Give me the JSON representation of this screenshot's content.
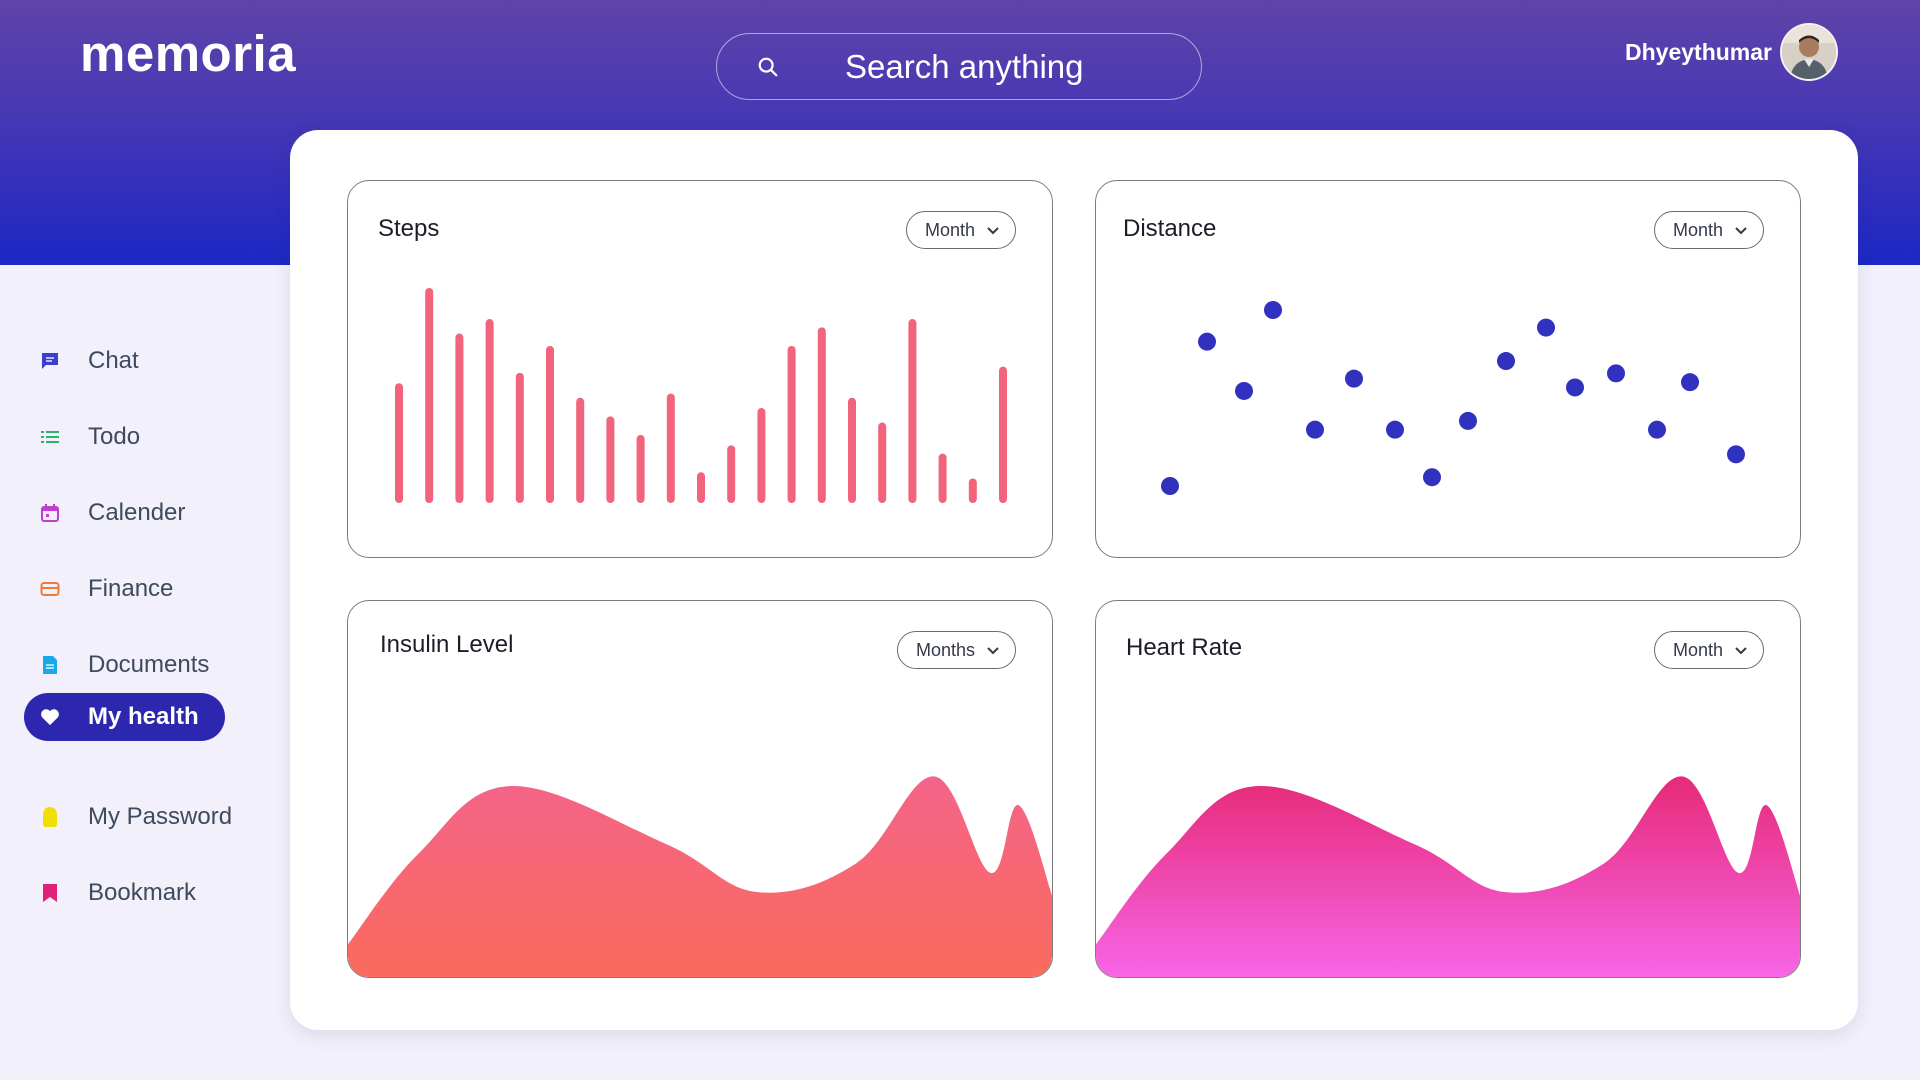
{
  "header": {
    "brand": "memoria",
    "search_placeholder": "Search anything",
    "user_name": "Dhyeythumar"
  },
  "sidebar": {
    "items": [
      {
        "label": "Chat",
        "icon": "chat-icon",
        "color": "#3b3fd0",
        "active": false
      },
      {
        "label": "Todo",
        "icon": "list-icon",
        "color": "#2fb36a",
        "active": false
      },
      {
        "label": "Calender",
        "icon": "calendar-icon",
        "color": "#c13fd0",
        "active": false
      },
      {
        "label": "Finance",
        "icon": "card-icon",
        "color": "#f07a3a",
        "active": false
      },
      {
        "label": "Documents",
        "icon": "document-icon",
        "color": "#1aa9e8",
        "active": false
      },
      {
        "label": "My health",
        "icon": "heart-icon",
        "color": "#ffffff",
        "active": true
      },
      {
        "label": "My Password",
        "icon": "lock-icon",
        "color": "#f0e000",
        "active": false
      },
      {
        "label": "Bookmark",
        "icon": "bookmark-icon",
        "color": "#e0207a",
        "active": false
      }
    ]
  },
  "cards": {
    "steps": {
      "title": "Steps",
      "dropdown": "Month"
    },
    "distance": {
      "title": "Distance",
      "dropdown": "Month"
    },
    "insulin": {
      "title": "Insulin Level",
      "dropdown": "Months"
    },
    "heart": {
      "title": "Heart Rate",
      "dropdown": "Month"
    }
  },
  "colors": {
    "bar": "#f2637c",
    "dot": "#3131c0",
    "insulin_gradient": [
      "#f46489",
      "#fb6a5c"
    ],
    "heart_gradient": [
      "#e62a77",
      "#f866e8"
    ]
  },
  "chart_data": [
    {
      "type": "bar",
      "title": "Steps",
      "ylim": [
        0,
        100
      ],
      "values": [
        54,
        100,
        78,
        85,
        59,
        72,
        47,
        38,
        29,
        49,
        11,
        24,
        42,
        72,
        81,
        47,
        35,
        85,
        20,
        8,
        62
      ]
    },
    {
      "type": "scatter",
      "title": "Distance",
      "xlim": [
        0,
        18
      ],
      "ylim": [
        0,
        100
      ],
      "points": [
        {
          "x": 0,
          "y": 0
        },
        {
          "x": 1,
          "y": 82
        },
        {
          "x": 2,
          "y": 54
        },
        {
          "x": 3,
          "y": 100
        },
        {
          "x": 4,
          "y": 32
        },
        {
          "x": 5,
          "y": 61
        },
        {
          "x": 6,
          "y": 32
        },
        {
          "x": 7,
          "y": 5
        },
        {
          "x": 8,
          "y": 37
        },
        {
          "x": 9,
          "y": 71
        },
        {
          "x": 10,
          "y": 90
        },
        {
          "x": 11,
          "y": 56
        },
        {
          "x": 12,
          "y": 64
        },
        {
          "x": 13,
          "y": 32
        },
        {
          "x": 14,
          "y": 59
        },
        {
          "x": 15,
          "y": 18
        }
      ]
    },
    {
      "type": "area",
      "title": "Insulin Level",
      "ylim": [
        0,
        100
      ],
      "x": [
        0,
        10,
        23,
        45,
        58,
        72,
        83,
        91,
        95,
        100
      ],
      "values": [
        18,
        65,
        100,
        70,
        45,
        60,
        105,
        55,
        90,
        40
      ]
    },
    {
      "type": "area",
      "title": "Heart Rate",
      "ylim": [
        0,
        100
      ],
      "x": [
        0,
        10,
        23,
        45,
        58,
        72,
        83,
        91,
        95,
        100
      ],
      "values": [
        18,
        65,
        100,
        70,
        45,
        60,
        105,
        55,
        90,
        40
      ]
    }
  ]
}
